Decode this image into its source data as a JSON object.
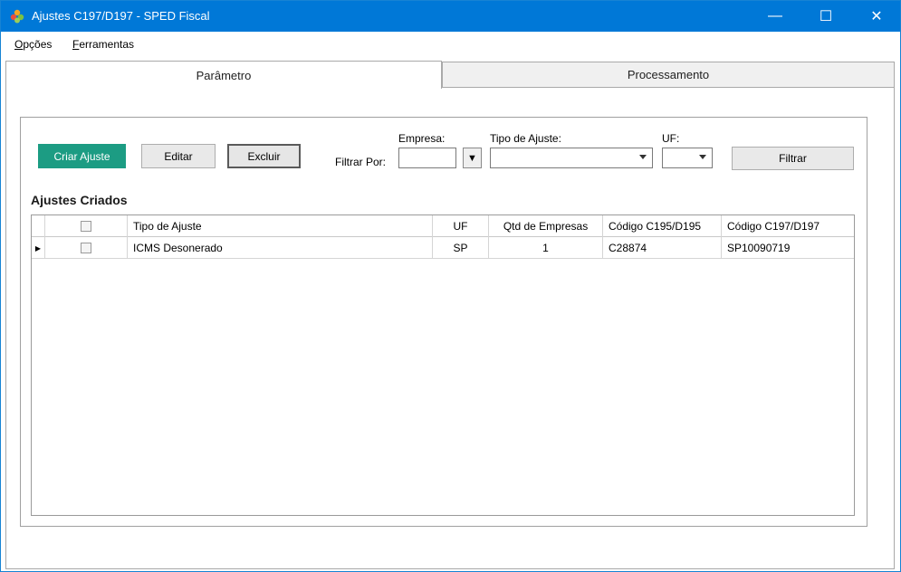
{
  "window": {
    "title": "Ajustes C197/D197 - SPED Fiscal",
    "minimize_glyph": "—",
    "maximize_glyph": "☐",
    "close_glyph": "✕"
  },
  "menu": {
    "opcoes": {
      "first": "O",
      "rest": "pções"
    },
    "ferramentas": {
      "first": "F",
      "rest": "erramentas"
    }
  },
  "tabs": [
    {
      "label": "Parâmetro"
    },
    {
      "label": "Processamento"
    }
  ],
  "toolbar": {
    "criar_label": "Criar Ajuste",
    "editar_label": "Editar",
    "excluir_label": "Excluir",
    "filtrar_label": "Filtrar"
  },
  "filters": {
    "filtrar_por_label": "Filtrar Por:",
    "empresa_label": "Empresa:",
    "empresa_value": "",
    "empresa_button": "▼",
    "tipo_label": "Tipo de Ajuste:",
    "tipo_value": "",
    "uf_label": "UF:",
    "uf_value": ""
  },
  "section": {
    "title": "Ajustes Criados"
  },
  "table": {
    "columns": [
      "Tipo de Ajuste",
      "UF",
      "Qtd de Empresas",
      "Código C195/D195",
      "Código C197/D197"
    ],
    "rows": [
      {
        "indicator": "▶",
        "tipo": "ICMS Desonerado",
        "uf": "SP",
        "qtd": "1",
        "c195": "C28874",
        "c197": "SP10090719"
      }
    ]
  },
  "colors": {
    "titlebar": "#0078d7",
    "accent_button": "#1c9c83"
  }
}
